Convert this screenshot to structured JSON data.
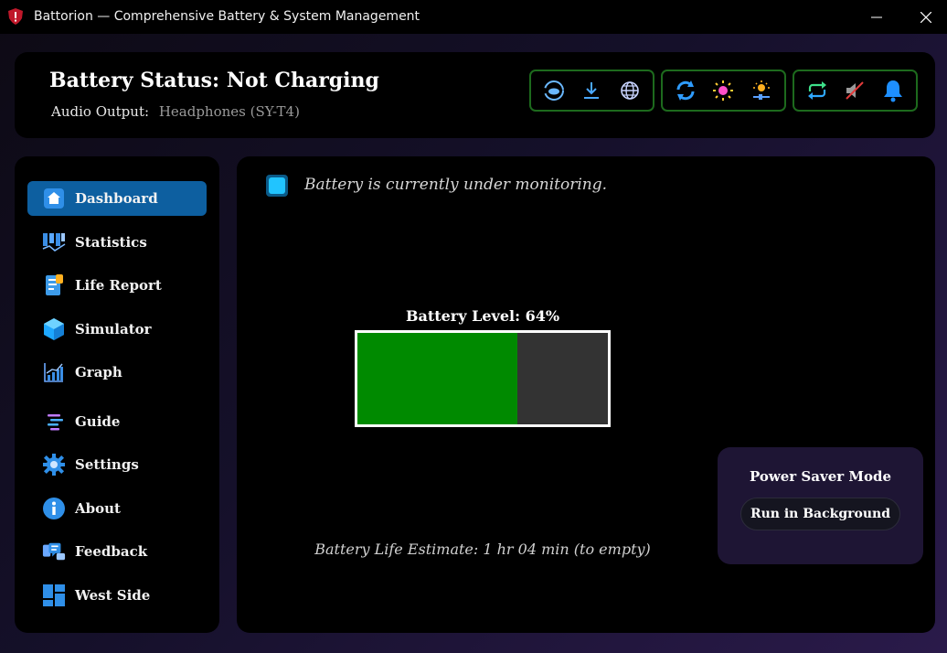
{
  "window": {
    "title": "Battorion — Comprehensive Battery & System Management",
    "minimize_glyph": "—",
    "close_glyph": "✕"
  },
  "header": {
    "status_title": "Battery Status: Not Charging",
    "audio_label": "Audio Output:",
    "audio_value": "Headphones (SY-T4)",
    "toolbar_icons": [
      "cloud-sync-icon",
      "download-icon",
      "globe-icon",
      "refresh-icon",
      "brightness-icon",
      "brightness-slider-icon",
      "loop-icon",
      "mute-icon",
      "bell-icon"
    ]
  },
  "sidebar": {
    "items": [
      {
        "label": "Dashboard",
        "icon": "home-icon",
        "active": true
      },
      {
        "label": "Statistics",
        "icon": "statistics-icon"
      },
      {
        "label": "Life Report",
        "icon": "report-icon"
      },
      {
        "label": "Simulator",
        "icon": "cube-icon"
      },
      {
        "label": "Graph",
        "icon": "graph-icon"
      },
      {
        "label": "Guide",
        "icon": "guide-icon"
      },
      {
        "label": "Settings",
        "icon": "gear-icon"
      },
      {
        "label": "About",
        "icon": "info-icon"
      },
      {
        "label": "Feedback",
        "icon": "feedback-icon"
      },
      {
        "label": "West Side",
        "icon": "grid-icon"
      }
    ]
  },
  "main": {
    "monitor_text": "Battery is currently under monitoring.",
    "battery_label": "Battery Level: 64%",
    "battery_level": 64,
    "estimate": "Battery Life Estimate: 1 hr 04 min (to empty)",
    "power_card": {
      "title": "Power Saver Mode",
      "button": "Run in Background"
    }
  },
  "colors": {
    "accent": "#0d5fa0",
    "battery_fill": "#008a00",
    "battery_empty": "#333333",
    "toolbar_border": "#1d6a1d",
    "power_card_bg": "#1e1534"
  }
}
